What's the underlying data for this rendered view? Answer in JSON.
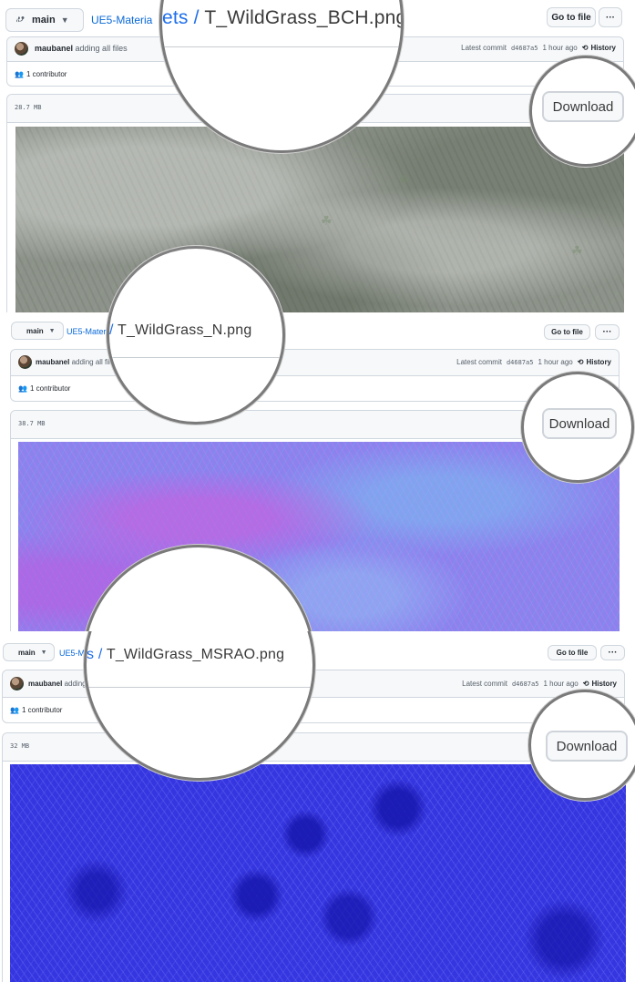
{
  "common": {
    "branch": "main",
    "goto_file": "Go to file",
    "more": "···",
    "author": "maubanel",
    "message": "adding all files",
    "latest_commit_label": "Latest commit",
    "commit_hash": "d4687a5",
    "commit_time": "1 hour ago",
    "history": "History",
    "contributors": "1 contributor",
    "download": "Download"
  },
  "panels": [
    {
      "crumb": "UE5-Materia",
      "mag_prefix": "ets / ",
      "filename": "T_WildGrass_BCH.png",
      "size": "28.7 MB"
    },
    {
      "crumb": "UE5-Materi",
      "mag_prefix": "/ ",
      "filename": "T_WildGrass_N.png",
      "size": "38.7 MB"
    },
    {
      "crumb": "UE5-M",
      "mag_prefix": "s / ",
      "filename": "T_WildGrass_MSRAO.png",
      "size": "32 MB"
    }
  ]
}
